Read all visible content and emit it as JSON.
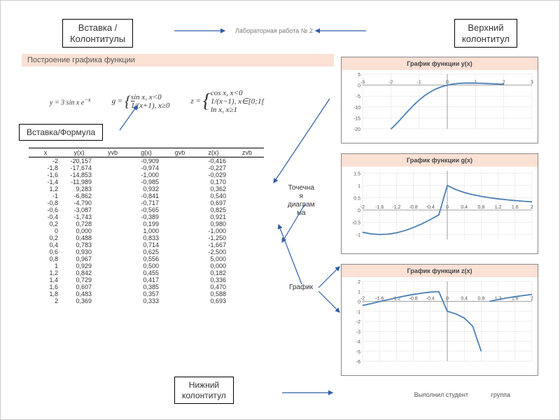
{
  "header": {
    "lab": "Лабораторная работа № 2"
  },
  "callouts": {
    "insert_headers": "Вставка /\nКолонтитулы",
    "top_header": "Верхний\nколонтитул",
    "insert_formula": "Вставка/Формула",
    "scatter": "Точечна\nя\nдиаграм\nма",
    "chart": "График",
    "bottom_header": "Нижний\nколонтитул"
  },
  "section_title": "Построение графика функции",
  "formulas": {
    "y": "y = 3 sin x · e^{-x}",
    "g": "g = { sin x, x < 0 ;  1/(x+1), x ≥ 0 }",
    "z": "z = { cos x, x < 0 ;  1/(x−1), x ∈ [0;1[ ;  ln x, x ≥ 1 }"
  },
  "table": {
    "headers": [
      "x",
      "y(x)",
      "yvb",
      "g(x)",
      "gvb",
      "z(x)",
      "zvb"
    ],
    "rows": [
      [
        "-2",
        "-20,157",
        "",
        "-0,909",
        "",
        "-0,416",
        ""
      ],
      [
        "-1,8",
        "-17,674",
        "",
        "-0,974",
        "",
        "-0,227",
        ""
      ],
      [
        "-1,6",
        "-14,853",
        "",
        "-1,000",
        "",
        "-0,029",
        ""
      ],
      [
        "-1,4",
        "-11,989",
        "",
        "-0,985",
        "",
        "0,170",
        ""
      ],
      [
        "1,2",
        "9,283",
        "",
        "0,932",
        "",
        "0,362",
        ""
      ],
      [
        "-1",
        "-6,862",
        "",
        "-0,841",
        "",
        "0,540",
        ""
      ],
      [
        "-0,8",
        "-4,790",
        "",
        "-0,717",
        "",
        "0,697",
        ""
      ],
      [
        "-0,6",
        "-3,087",
        "",
        "-0,565",
        "",
        "0,825",
        ""
      ],
      [
        "-0,4",
        "-1,743",
        "",
        "-0,389",
        "",
        "0,921",
        ""
      ],
      [
        "0,2",
        "0,728",
        "",
        "0,199",
        "",
        "0,980",
        ""
      ],
      [
        "0",
        "0,000",
        "",
        "1,000",
        "",
        "-1,000",
        ""
      ],
      [
        "0,2",
        "0,488",
        "",
        "0,833",
        "",
        "-1,250",
        ""
      ],
      [
        "0,4",
        "0,783",
        "",
        "0,714",
        "",
        "-1,667",
        ""
      ],
      [
        "0,6",
        "0,930",
        "",
        "0,625",
        "",
        "-2,500",
        ""
      ],
      [
        "0,8",
        "0,967",
        "",
        "0,556",
        "",
        "5,000",
        ""
      ],
      [
        "1",
        "0,929",
        "",
        "0,500",
        "",
        "0,000",
        ""
      ],
      [
        "1,2",
        "0,842",
        "",
        "0,455",
        "",
        "0,182",
        ""
      ],
      [
        "1,4",
        "0,729",
        "",
        "0,417",
        "",
        "0,336",
        ""
      ],
      [
        "1,6",
        "0,607",
        "",
        "0,385",
        "",
        "0,470",
        ""
      ],
      [
        "1,8",
        "0,483",
        "",
        "0,357",
        "",
        "0,588",
        ""
      ],
      [
        "2",
        "0,369",
        "",
        "0,333",
        "",
        "0,693",
        ""
      ]
    ]
  },
  "chart_data": [
    {
      "type": "line",
      "title": "График функции y(x)",
      "x": [
        -3,
        -2,
        -1,
        0,
        1,
        2,
        3
      ],
      "xticks": [
        -3,
        -2,
        -1,
        0,
        1,
        2,
        3
      ],
      "yticks": [
        -20,
        -15,
        -10,
        -5,
        0,
        5
      ],
      "series": [
        {
          "name": "y",
          "x": [
            -2,
            -1.8,
            -1.6,
            -1.4,
            -1.2,
            -1,
            -0.8,
            -0.6,
            -0.4,
            -0.2,
            0,
            0.2,
            0.4,
            0.6,
            0.8,
            1,
            1.2,
            1.4,
            1.6,
            1.8,
            2
          ],
          "y": [
            -20.157,
            -17.674,
            -14.853,
            -11.989,
            -9.283,
            -6.862,
            -4.79,
            -3.087,
            -1.743,
            -0.728,
            0,
            0.488,
            0.783,
            0.93,
            0.967,
            0.929,
            0.842,
            0.729,
            0.607,
            0.483,
            0.369
          ]
        }
      ],
      "xlim": [
        -3,
        3
      ],
      "ylim": [
        -20,
        5
      ]
    },
    {
      "type": "line",
      "title": "График функции g(x)",
      "xticks": [
        -2,
        -1.6,
        -1.2,
        -0.8,
        -0.4,
        0,
        0.4,
        0.8,
        1.2,
        1.6,
        2
      ],
      "yticks": [
        -1.0,
        -0.5,
        0,
        0.5,
        1.0,
        1.5
      ],
      "series": [
        {
          "name": "g",
          "x": [
            -2,
            -1.8,
            -1.6,
            -1.4,
            -1.2,
            -1,
            -0.8,
            -0.6,
            -0.4,
            -0.2,
            0,
            0.2,
            0.4,
            0.6,
            0.8,
            1,
            1.2,
            1.4,
            1.6,
            1.8,
            2
          ],
          "y": [
            -0.909,
            -0.974,
            -1.0,
            -0.985,
            -0.932,
            -0.841,
            -0.717,
            -0.565,
            -0.389,
            -0.199,
            1.0,
            0.833,
            0.714,
            0.625,
            0.556,
            0.5,
            0.455,
            0.417,
            0.385,
            0.357,
            0.333
          ]
        }
      ],
      "xlim": [
        -2,
        2
      ],
      "ylim": [
        -1.2,
        1.6
      ]
    },
    {
      "type": "line",
      "title": "График функции z(x)",
      "xticks": [
        -2,
        -1.6,
        -1.2,
        -0.8,
        -0.4,
        0,
        0.4,
        0.8,
        1.2,
        1.6,
        2
      ],
      "yticks": [
        -6,
        -5,
        -4,
        -3,
        -2,
        -1,
        0,
        1,
        2
      ],
      "series": [
        {
          "name": "z",
          "x": [
            -2,
            -1.8,
            -1.6,
            -1.4,
            -1.2,
            -1,
            -0.8,
            -0.6,
            -0.4,
            -0.2,
            0,
            0.2,
            0.4,
            0.6,
            0.8,
            1,
            1.2,
            1.4,
            1.6,
            1.8,
            2
          ],
          "y": [
            -0.416,
            -0.227,
            -0.029,
            0.17,
            0.362,
            0.54,
            0.697,
            0.825,
            0.921,
            0.98,
            -1.0,
            -1.25,
            -1.667,
            -2.5,
            -5.0,
            0.0,
            0.182,
            0.336,
            0.47,
            0.588,
            0.693
          ]
        }
      ],
      "xlim": [
        -2,
        2
      ],
      "ylim": [
        -6,
        2
      ]
    }
  ],
  "footer": {
    "student": "Выполнил студент",
    "group": "группа"
  }
}
